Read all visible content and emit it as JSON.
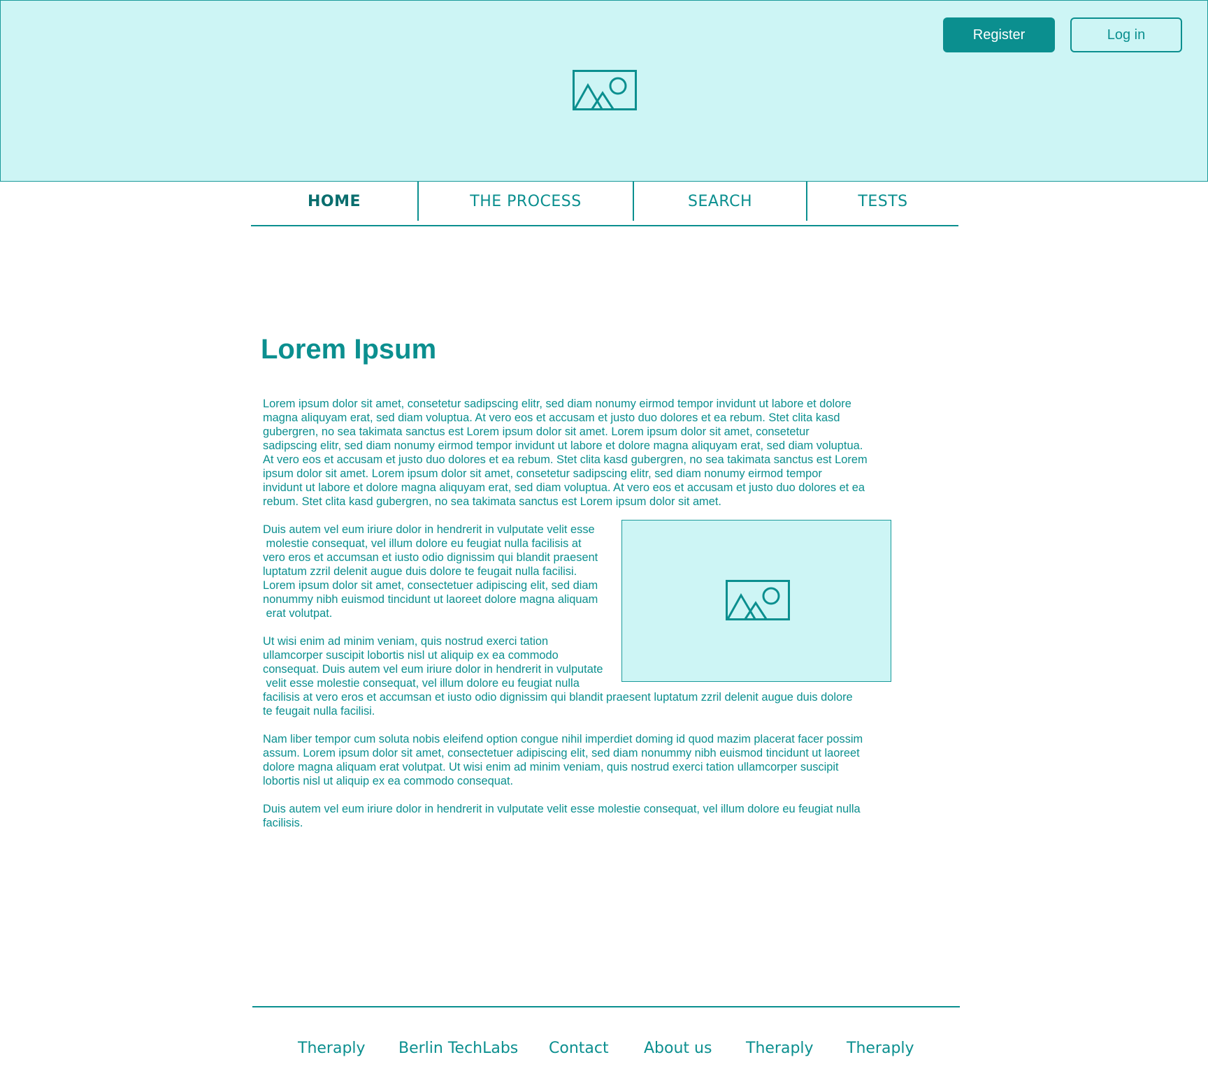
{
  "header": {
    "register_label": "Register",
    "login_label": "Log in",
    "hero_image_icon": "image-placeholder-icon"
  },
  "nav": {
    "items": [
      {
        "label": "HOME",
        "active": true
      },
      {
        "label": "THE PROCESS",
        "active": false
      },
      {
        "label": "SEARCH",
        "active": false
      },
      {
        "label": "TESTS",
        "active": false
      }
    ]
  },
  "main": {
    "title": "Lorem Ipsum",
    "paragraphs": [
      "Lorem ipsum dolor sit amet, consetetur sadipscing elitr, sed diam nonumy eirmod tempor invidunt ut labore et dolore\nmagna aliquyam erat, sed diam voluptua. At vero eos et accusam et justo duo dolores et ea rebum. Stet clita kasd\ngubergren, no sea takimata sanctus est Lorem ipsum dolor sit amet. Lorem ipsum dolor sit amet, consetetur\nsadipscing elitr, sed diam nonumy eirmod tempor invidunt ut labore et dolore magna aliquyam erat, sed diam voluptua.\nAt vero eos et accusam et justo duo dolores et ea rebum. Stet clita kasd gubergren, no sea takimata sanctus est Lorem\nipsum dolor sit amet. Lorem ipsum dolor sit amet, consetetur sadipscing elitr, sed diam nonumy eirmod tempor\ninvidunt ut labore et dolore magna aliquyam erat, sed diam voluptua. At vero eos et accusam et justo duo dolores et ea\nrebum. Stet clita kasd gubergren, no sea takimata sanctus est Lorem ipsum dolor sit amet.",
      "Duis autem vel eum iriure dolor in hendrerit in vulputate velit esse\n molestie consequat, vel illum dolore eu feugiat nulla facilisis at\nvero eros et accumsan et iusto odio dignissim qui blandit praesent\nluptatum zzril delenit augue duis dolore te feugait nulla facilisi.\nLorem ipsum dolor sit amet, consectetuer adipiscing elit, sed diam\nnonummy nibh euismod tincidunt ut laoreet dolore magna aliquam\n erat volutpat.",
      "Ut wisi enim ad minim veniam, quis nostrud exerci tation\nullamcorper suscipit lobortis nisl ut aliquip ex ea commodo\nconsequat. Duis autem vel eum iriure dolor in hendrerit in vulputate\n velit esse molestie consequat, vel illum dolore eu feugiat nulla\nfacilisis at vero eros et accumsan et iusto odio dignissim qui blandit praesent luptatum zzril delenit augue duis dolore\nte feugait nulla facilisi.",
      "Nam liber tempor cum soluta nobis eleifend option congue nihil imperdiet doming id quod mazim placerat facer possim\nassum. Lorem ipsum dolor sit amet, consectetuer adipiscing elit, sed diam nonummy nibh euismod tincidunt ut laoreet\ndolore magna aliquam erat volutpat. Ut wisi enim ad minim veniam, quis nostrud exerci tation ullamcorper suscipit\nlobortis nisl ut aliquip ex ea commodo consequat.",
      "Duis autem vel eum iriure dolor in hendrerit in vulputate velit esse molestie consequat, vel illum dolore eu feugiat nulla\nfacilisis."
    ],
    "content_image_icon": "image-placeholder-icon"
  },
  "footer": {
    "links": [
      "Theraply",
      "Berlin TechLabs",
      "Contact",
      "About us",
      "Theraply",
      "Theraply"
    ]
  },
  "colors": {
    "accent": "#0b8f8f",
    "header_bg": "#cdf5f5",
    "page_bg": "#ffffff"
  }
}
